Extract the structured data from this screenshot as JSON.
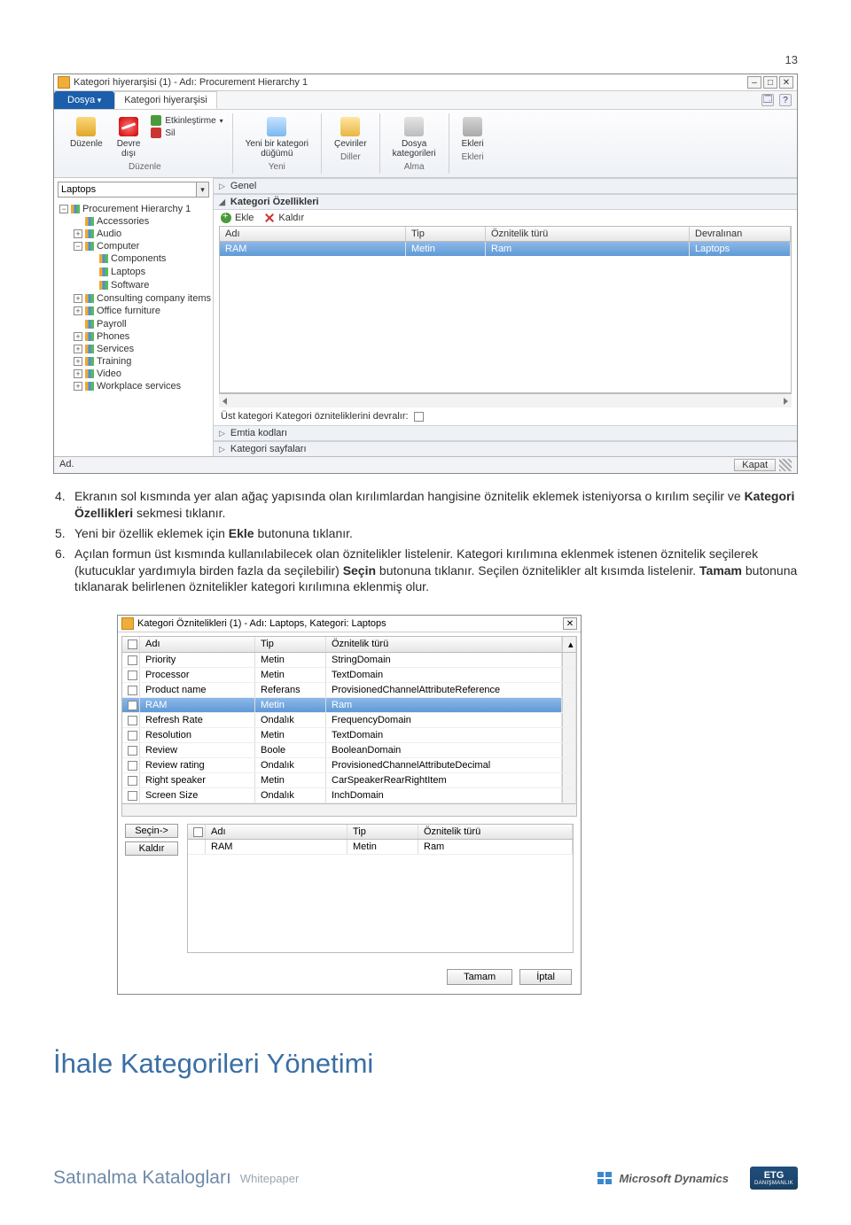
{
  "page_number": "13",
  "window1": {
    "title": "Kategori hiyerarşisi (1) - Adı: Procurement Hierarchy 1",
    "tabs": {
      "file": "Dosya",
      "active": "Kategori hiyerarşisi"
    },
    "ribbon": {
      "small_activate": "Etkinleştirme",
      "small_delete": "Sil",
      "edit": "Düzenle",
      "disable": "Devre\ndışı",
      "group_edit": "Düzenle",
      "new_category": "Yeni bir kategori\ndüğümü",
      "group_new": "Yeni",
      "translations": "Çeviriler",
      "group_lang": "Diller",
      "file_cats": "Dosya\nkategorileri",
      "group_import": "Alma",
      "attachments": "Ekleri",
      "group_attach": "Ekleri"
    },
    "tree_selected": "Laptops",
    "tree": {
      "root": "Procurement Hierarchy 1",
      "items": [
        "Accessories",
        "Audio",
        "Computer",
        "Components",
        "Laptops",
        "Software",
        "Consulting company items",
        "Office furniture",
        "Payroll",
        "Phones",
        "Services",
        "Training",
        "Video",
        "Workplace services"
      ]
    },
    "sections": {
      "genel": "Genel",
      "ozellik": "Kategori Özellikleri",
      "add": "Ekle",
      "remove": "Kaldır",
      "cols": {
        "a": "Adı",
        "b": "Tip",
        "c": "Öznitelik türü",
        "d": "Devralınan"
      },
      "row": {
        "a": "RAM",
        "b": "Metin",
        "c": "Ram",
        "d": "Laptops"
      },
      "inherit": "Üst kategori Kategori özniteliklerini devralır:",
      "emtia": "Emtia kodları",
      "pages": "Kategori sayfaları"
    },
    "status": {
      "left": "Ad.",
      "close": "Kapat"
    }
  },
  "body": {
    "li4": "Ekranın sol kısmında yer alan ağaç yapısında olan kırılımlardan hangisine öznitelik eklemek isteniyorsa o kırılım seçilir ve ",
    "li4b": "Kategori Özellikleri",
    "li4c": " sekmesi tıklanır.",
    "li5": "Yeni bir özellik eklemek için ",
    "li5b": "Ekle",
    "li5c": " butonuna tıklanır.",
    "li6a": "Açılan formun üst kısmında kullanılabilecek olan öznitelikler listelenir. Kategori kırılımına eklenmek istenen öznitelik seçilerek (kutucuklar yardımıyla birden fazla da seçilebilir) ",
    "li6b": "Seçin",
    "li6c": " butonuna tıklanır. Seçilen öznitelikler alt kısımda listelenir. ",
    "li6d": "Tamam",
    "li6e": " butonuna tıklanarak belirlenen öznitelikler kategori kırılımına eklenmiş olur."
  },
  "dialog": {
    "title": "Kategori Öznitelikleri (1) - Adı: Laptops, Kategori: Laptops",
    "cols": {
      "a": "Adı",
      "b": "Tip",
      "c": "Öznitelik türü"
    },
    "rows": [
      {
        "a": "Priority",
        "b": "Metin",
        "c": "StringDomain"
      },
      {
        "a": "Processor",
        "b": "Metin",
        "c": "TextDomain"
      },
      {
        "a": "Product name",
        "b": "Referans",
        "c": "ProvisionedChannelAttributeReference"
      },
      {
        "a": "RAM",
        "b": "Metin",
        "c": "Ram",
        "sel": true
      },
      {
        "a": "Refresh Rate",
        "b": "Ondalık",
        "c": "FrequencyDomain"
      },
      {
        "a": "Resolution",
        "b": "Metin",
        "c": "TextDomain"
      },
      {
        "a": "Review",
        "b": "Boole",
        "c": "BooleanDomain"
      },
      {
        "a": "Review rating",
        "b": "Ondalık",
        "c": "ProvisionedChannelAttributeDecimal"
      },
      {
        "a": "Right speaker",
        "b": "Metin",
        "c": "CarSpeakerRearRightItem"
      },
      {
        "a": "Screen Size",
        "b": "Ondalık",
        "c": "InchDomain"
      }
    ],
    "btn_select": "Seçin->",
    "btn_remove": "Kaldır",
    "lower_cols": {
      "a": "Adı",
      "b": "Tip",
      "c": "Öznitelik türü"
    },
    "lower_row": {
      "a": "RAM",
      "b": "Metin",
      "c": "Ram"
    },
    "ok": "Tamam",
    "cancel": "İptal"
  },
  "section_title": "İhale Kategorileri Yönetimi",
  "footer": {
    "main": "Satınalma Katalogları",
    "sub": "Whitepaper",
    "dynamics": "Microsoft Dynamics",
    "etg": "ETG",
    "etg_sub": "DANIŞMANLIK"
  }
}
